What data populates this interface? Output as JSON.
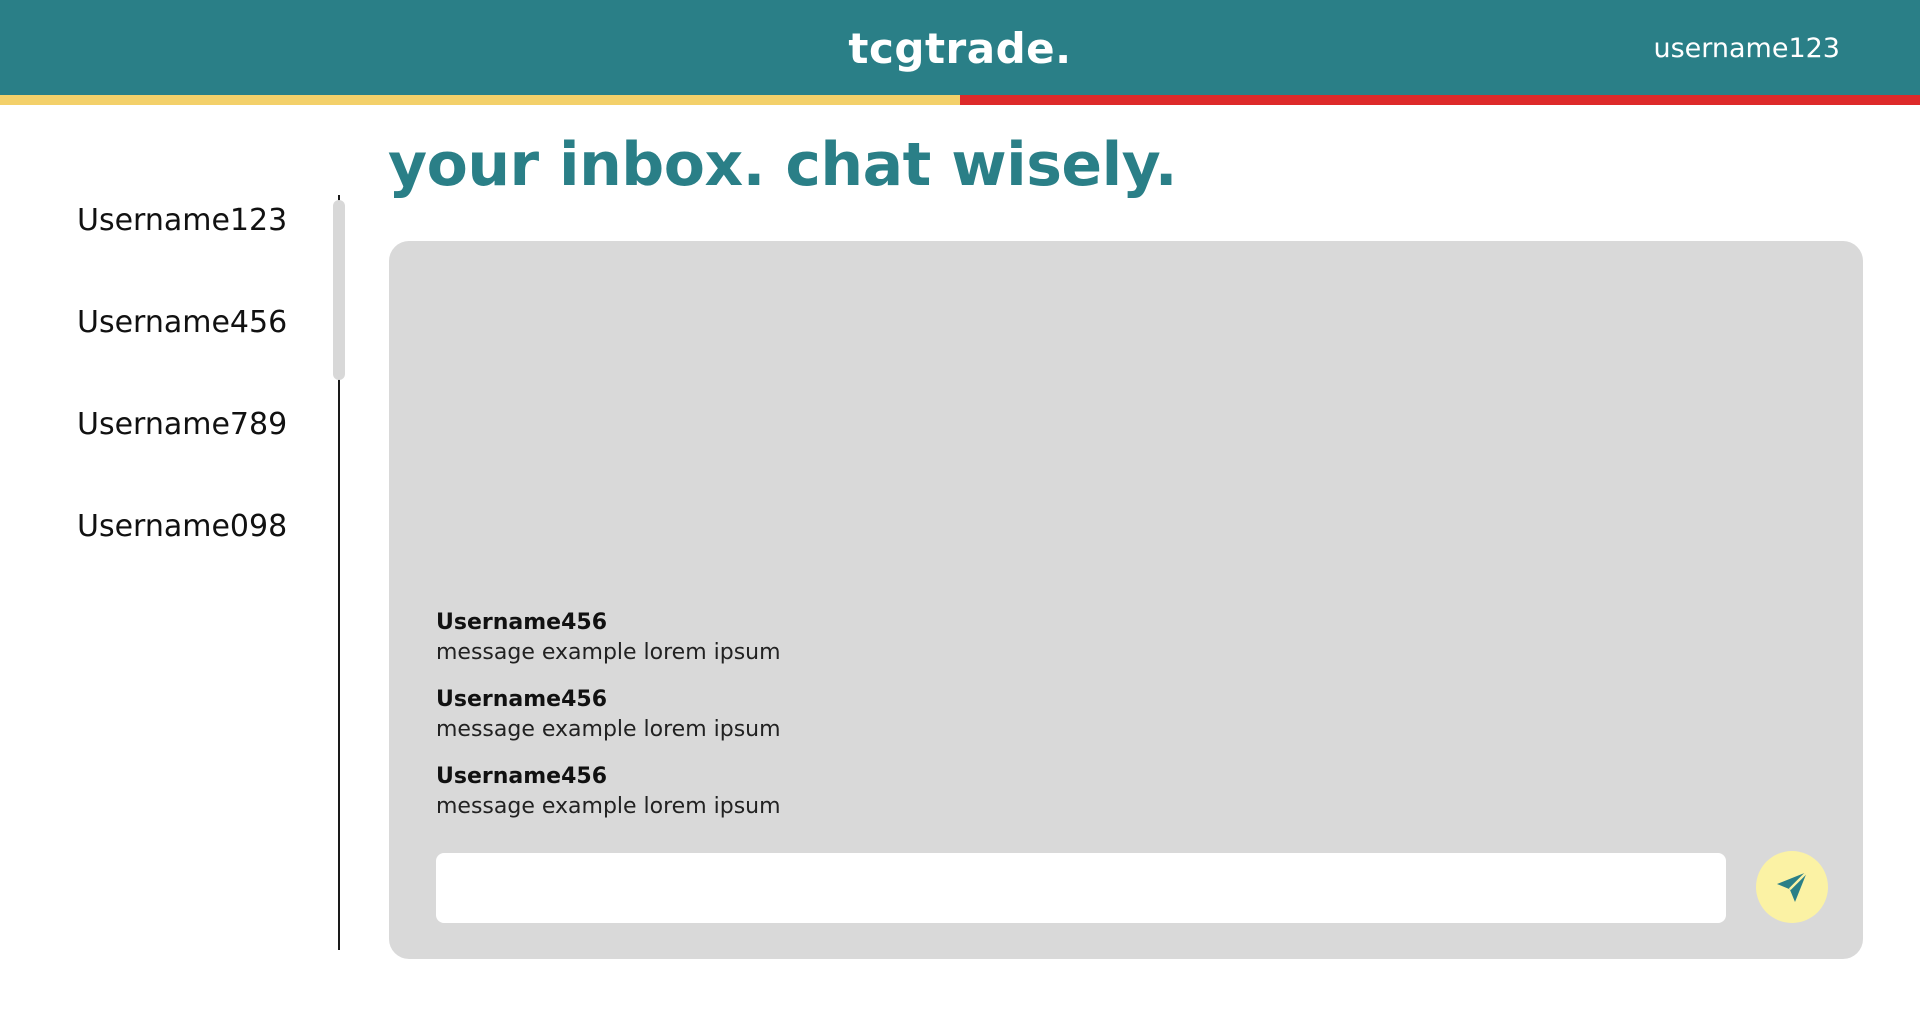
{
  "header": {
    "brand": "tcgtrade.",
    "current_user": "username123"
  },
  "sidebar": {
    "contacts": [
      {
        "label": "Username123"
      },
      {
        "label": "Username456"
      },
      {
        "label": "Username789"
      },
      {
        "label": "Username098"
      }
    ]
  },
  "main": {
    "title": "your inbox. chat wisely.",
    "messages": [
      {
        "author": "Username456",
        "text": "message example lorem ipsum"
      },
      {
        "author": "Username456",
        "text": "message example lorem ipsum"
      },
      {
        "author": "Username456",
        "text": "message example lorem ipsum"
      }
    ],
    "input": {
      "value": "",
      "placeholder": ""
    },
    "send_icon": "send-icon"
  },
  "colors": {
    "brand_teal": "#2a7f87",
    "stripe_yellow": "#f3d06a",
    "stripe_red": "#dd2a2a",
    "panel_gray": "#d9d9d9",
    "send_button_yellow": "#fbf2a4"
  }
}
